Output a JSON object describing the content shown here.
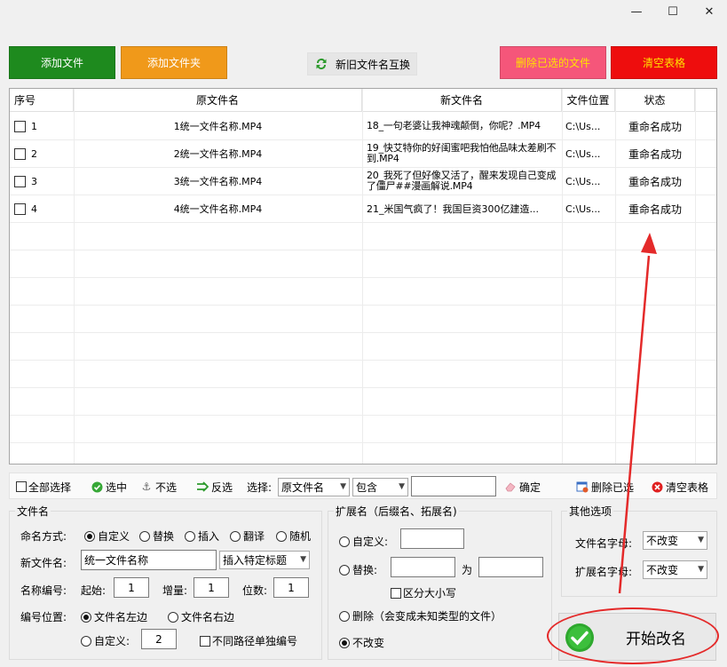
{
  "window": {
    "minimize": "—",
    "maximize": "☐",
    "close": "✕"
  },
  "top_buttons": {
    "add_file": "添加文件",
    "add_folder": "添加文件夹",
    "swap": "新旧文件名互换",
    "delete_selected": "删除已选的文件",
    "clear_table": "清空表格"
  },
  "table": {
    "headers": {
      "index": "序号",
      "old_name": "原文件名",
      "new_name": "新文件名",
      "location": "文件位置",
      "status": "状态"
    },
    "rows": [
      {
        "index": "1",
        "old_name": "1统一文件名称.MP4",
        "new_name": "18_一句老婆让我神魂颠倒，你呢？.MP4",
        "location": "C:\\Us...",
        "status": "重命名成功"
      },
      {
        "index": "2",
        "old_name": "2统一文件名称.MP4",
        "new_name": "19_快艾特你的好闺蜜吧我怕他品味太差刷不到.MP4",
        "location": "C:\\Us...",
        "status": "重命名成功"
      },
      {
        "index": "3",
        "old_name": "3统一文件名称.MP4",
        "new_name": "20_我死了但好像又活了，醒来发现自己变成了僵尸##漫画解说.MP4",
        "location": "C:\\Us...",
        "status": "重命名成功"
      },
      {
        "index": "4",
        "old_name": "4统一文件名称.MP4",
        "new_name": "21_米国气疯了！我国巨资300亿建造...",
        "location": "C:\\Us...",
        "status": "重命名成功"
      }
    ]
  },
  "toolbar": {
    "select_all": "全部选择",
    "select": "选中",
    "deselect": "不选",
    "invert": "反选",
    "filter_label": "选择:",
    "filter_field": "原文件名",
    "filter_op": "包含",
    "filter_value": "",
    "confirm": "确定",
    "delete_selected": "删除已选",
    "clear_table": "清空表格"
  },
  "filename_group": {
    "title": "文件名",
    "mode_label": "命名方式:",
    "modes": [
      "自定义",
      "替换",
      "插入",
      "翻译",
      "随机"
    ],
    "mode_selected": "自定义",
    "new_name_label": "新文件名:",
    "new_name_value": "统一文件名称",
    "insert_title": "插入特定标题",
    "numbering_label": "名称编号:",
    "start_label": "起始:",
    "start_value": "1",
    "increment_label": "增量:",
    "increment_value": "1",
    "digits_label": "位数:",
    "digits_value": "1",
    "position_label": "编号位置:",
    "position_left": "文件名左边",
    "position_right": "文件名右边",
    "position_custom": "自定义:",
    "position_custom_value": "2",
    "separate_paths": "不同路径单独编号"
  },
  "ext_group": {
    "title": "扩展名（后缀名、拓展名)",
    "custom_label": "自定义:",
    "custom_value": "",
    "replace_label": "替换:",
    "replace_from": "",
    "replace_as": "为",
    "replace_to": "",
    "case_sensitive": "区分大小写",
    "delete_label": "删除（会变成未知类型的文件）",
    "keep_label": "不改变"
  },
  "other_group": {
    "title": "其他选项",
    "filename_case_label": "文件名字母:",
    "filename_case_value": "不改变",
    "ext_case_label": "扩展名字母:",
    "ext_case_value": "不改变"
  },
  "start_button": "开始改名",
  "colors": {
    "add_file": "#1e8a1e",
    "add_folder": "#f0991a",
    "delete_selected": "#f5567a",
    "clear_table": "#ee0d0d",
    "annotation": "#e42a2a"
  }
}
